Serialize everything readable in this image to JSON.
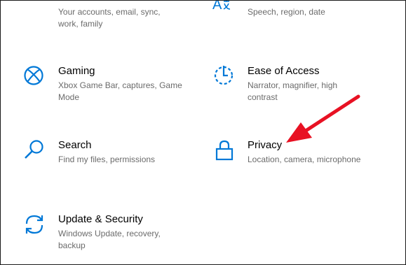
{
  "accent_color": "#0078d7",
  "annotation_color": "#e81123",
  "tiles": {
    "accounts": {
      "icon": "person-icon",
      "desc": "Your accounts, email, sync, work, family"
    },
    "time_language": {
      "icon": "language-icon",
      "desc": "Speech, region, date"
    },
    "gaming": {
      "icon": "xbox-icon",
      "title": "Gaming",
      "desc": "Xbox Game Bar, captures, Game Mode"
    },
    "ease_of_access": {
      "icon": "ease-of-access-icon",
      "title": "Ease of Access",
      "desc": "Narrator, magnifier, high contrast"
    },
    "search": {
      "icon": "search-icon",
      "title": "Search",
      "desc": "Find my files, permissions"
    },
    "privacy": {
      "icon": "lock-icon",
      "title": "Privacy",
      "desc": "Location, camera, microphone"
    },
    "update_security": {
      "icon": "sync-icon",
      "title": "Update & Security",
      "desc": "Windows Update, recovery, backup"
    }
  }
}
